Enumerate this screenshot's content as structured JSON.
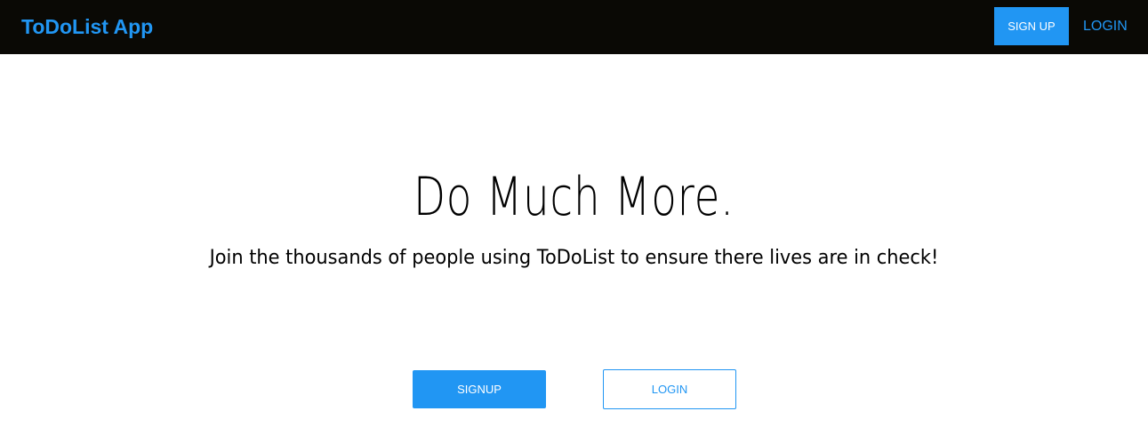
{
  "navbar": {
    "brand": "ToDoList App",
    "signup_label": "SIGN UP",
    "login_label": "LOGIN"
  },
  "hero": {
    "title": "Do Much More.",
    "subtitle": "Join the thousands of people using ToDoList to ensure there lives are in check!"
  },
  "actions": {
    "signup_label": "SIGNUP",
    "login_label": "LOGIN"
  },
  "colors": {
    "accent": "#2196f3",
    "navbar_bg": "#0a0905",
    "page_bg": "#ffffff",
    "text": "#000000"
  }
}
